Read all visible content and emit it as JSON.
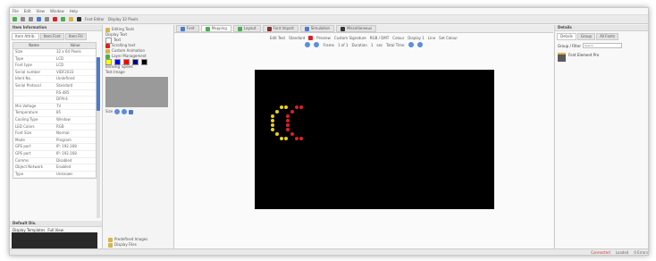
{
  "menu": [
    "File",
    "Edit",
    "View",
    "Window",
    "Help"
  ],
  "toolbar": {
    "text1": "Font Editor",
    "text2": "Display 32 Pixels"
  },
  "left_panel": {
    "title": "Item Information",
    "tabs": [
      "Item Attrib.",
      "Item Font",
      "Item Fill"
    ],
    "table_headers": [
      "Name",
      "Value"
    ],
    "rows": [
      [
        "Size",
        "32 x 64 Pixels"
      ],
      [
        "Type",
        "LCD"
      ],
      [
        "Font type",
        "LCD"
      ],
      [
        "Serial number",
        "VIDF2033"
      ],
      [
        "Ident No.",
        "Undefined"
      ],
      [
        "Serial Protocol",
        "Standard"
      ],
      [
        "",
        "RS-485"
      ],
      [
        "",
        "DFM-4"
      ],
      [
        "Min Voltage",
        "7V"
      ],
      [
        "Temperature",
        "85"
      ],
      [
        "Cooling Type",
        "Window"
      ],
      [
        "LED Colors",
        "RGB"
      ],
      [
        "Font Size",
        "Normal"
      ],
      [
        "Mode",
        "Program"
      ],
      [
        "GPS port",
        "IP: 192.168"
      ],
      [
        "GPS port",
        "IP: 192.168"
      ],
      [
        "Comms",
        "Disabled"
      ],
      [
        "Object Network",
        "Enabled"
      ],
      [
        "Type",
        "Unknown"
      ]
    ],
    "section2": "Default Dis.",
    "section2_items": [
      "Display Templates",
      "Full View"
    ]
  },
  "mid_panel": {
    "title": "Editing Tools",
    "section": "Display Text",
    "items": [
      "Text",
      "Scrolling text",
      "Custom Animation",
      "Layer Management"
    ],
    "swatch_colors": [
      "#ffff00",
      "#0000ff",
      "#ff0000",
      "#000080",
      "#000000"
    ],
    "blinking": "Blinking",
    "speed": "Speed",
    "image_label": "Test Image",
    "size_label": "Size",
    "bottom": [
      "Predefined Images",
      "Display Files"
    ]
  },
  "main": {
    "tabs": [
      "Font",
      "Mapping",
      "Layout",
      "Font Import",
      "Simulation",
      "Miscellaneous"
    ],
    "options": [
      "Edit Text",
      "Standard",
      "Preview",
      "Custom Signature",
      "RGB / DMT",
      "Colour",
      "Display 1",
      "Line",
      "Set Colour"
    ],
    "nav": [
      "Frame",
      "1 of 1",
      "Duration",
      "1",
      "sec",
      "Total Time"
    ]
  },
  "right_panel": {
    "title": "Details",
    "tabs": [
      "Details",
      "Group",
      "All Fonts"
    ],
    "search_label": "Group / Filter",
    "search_placeholder": "Search",
    "file_name": "Font Element Pro"
  },
  "status": [
    "Connected",
    "Loaded",
    "0 Errors"
  ],
  "colors": {
    "accent": "#4b7bd1",
    "screen": "#000000",
    "led_yellow": "#e8d21a",
    "led_red": "#e02020"
  }
}
